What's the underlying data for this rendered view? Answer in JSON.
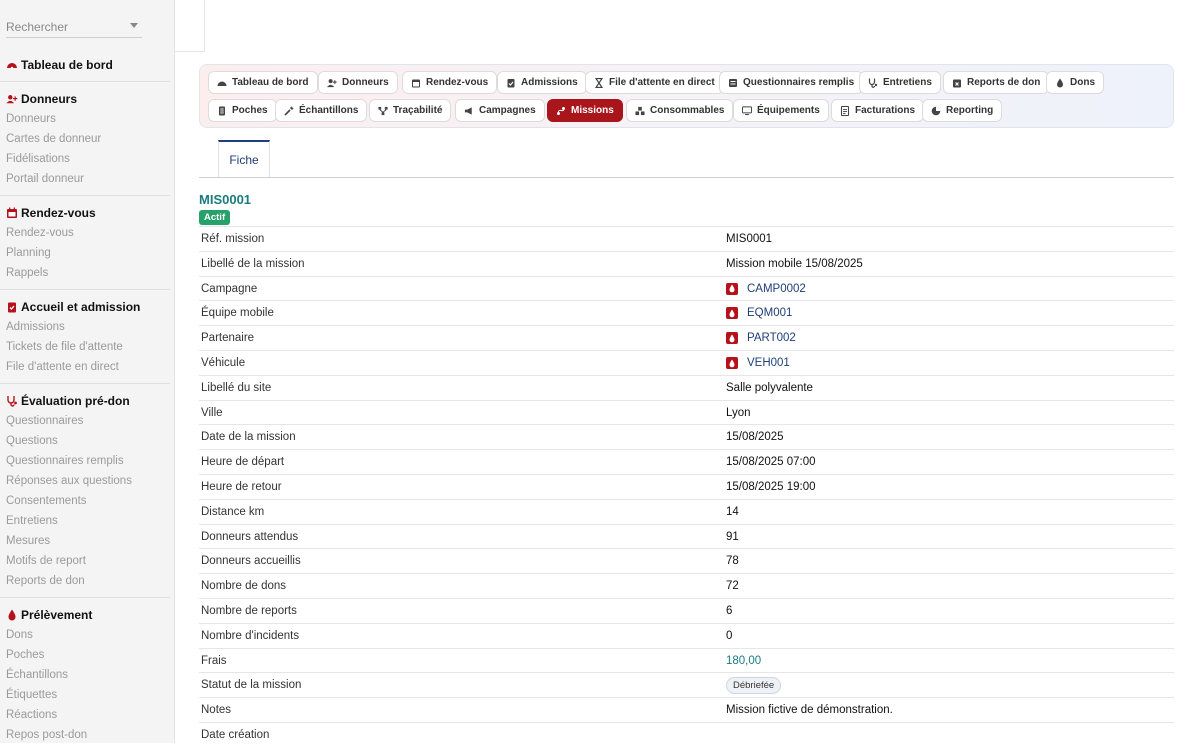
{
  "sidebar": {
    "search_placeholder": "Rechercher",
    "sections": [
      {
        "title": "Tableau de bord",
        "items": []
      },
      {
        "title": "Donneurs",
        "items": [
          "Donneurs",
          "Cartes de donneur",
          "Fidélisations",
          "Portail donneur"
        ]
      },
      {
        "title": "Rendez-vous",
        "items": [
          "Rendez-vous",
          "Planning",
          "Rappels"
        ]
      },
      {
        "title": "Accueil et admission",
        "items": [
          "Admissions",
          "Tickets de file d'attente",
          "File d'attente en direct"
        ]
      },
      {
        "title": "Évaluation pré-don",
        "items": [
          "Questionnaires",
          "Questions",
          "Questionnaires remplis",
          "Réponses aux questions",
          "Consentements",
          "Entretiens",
          "Mesures",
          "Motifs de report",
          "Reports de don"
        ]
      },
      {
        "title": "Prélèvement",
        "items": [
          "Dons",
          "Poches",
          "Échantillons",
          "Étiquettes",
          "Réactions",
          "Repos post-don"
        ]
      }
    ]
  },
  "nav": {
    "row1": [
      "Tableau de bord",
      "Donneurs",
      "Rendez-vous",
      "Admissions",
      "File d'attente en direct",
      "Questionnaires remplis",
      "Entretiens",
      "Reports de don",
      "Dons"
    ],
    "row2": [
      "Poches",
      "Échantillons",
      "Traçabilité",
      "Campagnes",
      "Missions",
      "Consommables",
      "Équipements",
      "Facturations",
      "Reporting"
    ],
    "active": "Missions"
  },
  "tabs": {
    "fiche": "Fiche"
  },
  "record": {
    "title": "MIS0001",
    "status_badge": "Actif",
    "fields": [
      {
        "label": "Réf. mission",
        "value": "MIS0001",
        "kind": "text"
      },
      {
        "label": "Libellé de la mission",
        "value": "Mission mobile 15/08/2025",
        "kind": "text"
      },
      {
        "label": "Campagne",
        "value": "CAMP0002",
        "kind": "link"
      },
      {
        "label": "Équipe mobile",
        "value": "EQM001",
        "kind": "link"
      },
      {
        "label": "Partenaire",
        "value": "PART002",
        "kind": "link"
      },
      {
        "label": "Véhicule",
        "value": "VEH001",
        "kind": "link"
      },
      {
        "label": "Libellé du site",
        "value": "Salle polyvalente",
        "kind": "text"
      },
      {
        "label": "Ville",
        "value": "Lyon",
        "kind": "text"
      },
      {
        "label": "Date de la mission",
        "value": "15/08/2025",
        "kind": "text"
      },
      {
        "label": "Heure de départ",
        "value": "15/08/2025 07:00",
        "kind": "text"
      },
      {
        "label": "Heure de retour",
        "value": "15/08/2025 19:00",
        "kind": "text"
      },
      {
        "label": "Distance km",
        "value": "14",
        "kind": "text"
      },
      {
        "label": "Donneurs attendus",
        "value": "91",
        "kind": "text"
      },
      {
        "label": "Donneurs accueillis",
        "value": "78",
        "kind": "text"
      },
      {
        "label": "Nombre de dons",
        "value": "72",
        "kind": "text"
      },
      {
        "label": "Nombre de reports",
        "value": "6",
        "kind": "text"
      },
      {
        "label": "Nombre d'incidents",
        "value": "0",
        "kind": "text"
      },
      {
        "label": "Frais",
        "value": "180,00",
        "kind": "money"
      },
      {
        "label": "Statut de la mission",
        "value": "Débriefée",
        "kind": "chip"
      },
      {
        "label": "Notes",
        "value": "Mission fictive de démonstration.",
        "kind": "text"
      },
      {
        "label": "Date création",
        "value": "",
        "kind": "text"
      }
    ]
  },
  "colors": {
    "brand_red": "#a8161c",
    "link_blue": "#1d3f7a",
    "teal": "#1a7c80",
    "success": "#27a06a"
  }
}
